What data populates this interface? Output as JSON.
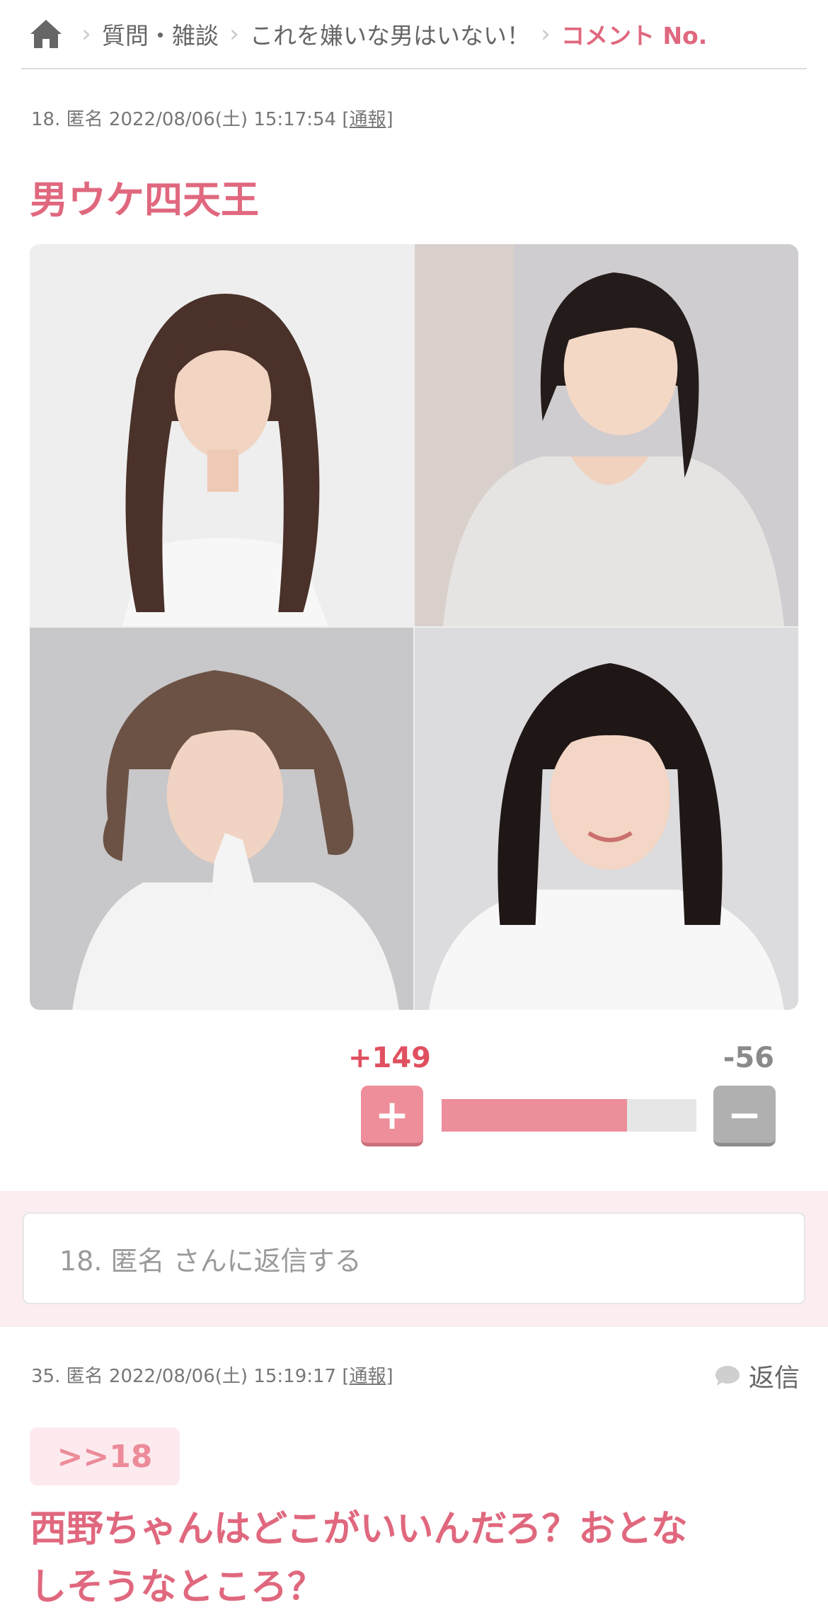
{
  "breadcrumb": {
    "items": [
      "質問・雑談",
      "これを嫌いな男はいない！"
    ],
    "current": "コメント No."
  },
  "comments": [
    {
      "number": "18.",
      "author": "匿名",
      "datetime": "2022/08/06(土) 15:17:54",
      "report": "通報",
      "text": "男ウケ四天王",
      "votes": {
        "plus": "+149",
        "minus": "-56",
        "plus_ratio": 0.727
      },
      "reply_placeholder": "18. 匿名 さんに返信する"
    },
    {
      "number": "35.",
      "author": "匿名",
      "datetime": "2022/08/06(土) 15:19:17",
      "report": "通報",
      "reply_label": "返信",
      "anchor": ">>18",
      "text_line1": "西野ちゃんはどこがいいんだろ？おとな",
      "text_line2": "しそうなところ？"
    }
  ],
  "colors": {
    "accent": "#e0687e",
    "plus": "#ee8e9a",
    "minus": "#b0b0b0",
    "reply_band": "#fcedf1"
  }
}
